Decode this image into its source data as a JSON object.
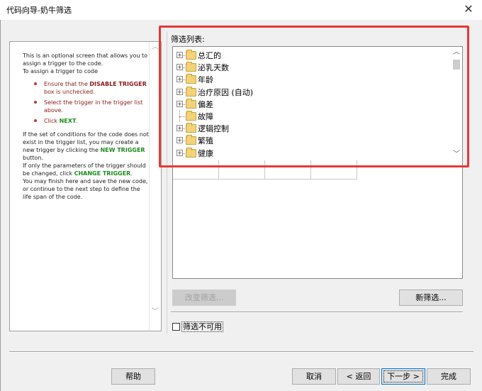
{
  "window": {
    "title": "代码向导-奶牛筛选",
    "close_glyph": "✕"
  },
  "help": {
    "intro": "This is an optional screen that allows you to assign a trigger to the code.",
    "intro2": "To assign a trigger to code",
    "steps": [
      {
        "pre": "Ensure that the ",
        "kw": "DISABLE TRIGGER",
        "post": " box is unchecked."
      },
      {
        "pre": "Select the trigger in the trigger list above.",
        "kw": "",
        "post": ""
      },
      {
        "pre": "Click ",
        "kw": "NEXT",
        "post": "."
      }
    ],
    "para2_pre": "If the set of conditions for the code does not exist in the trigger list, you may create a new trigger by clicking the ",
    "para2_kw": "NEW TRIGGER",
    "para2_post": " button.",
    "para3_pre": "If only the parameters of the trigger should be changed, click ",
    "para3_kw": "CHANGE TRIGGER",
    "para3_post": ".",
    "para4": "You may finish here and save the new code, or continue to the next step to define the life span of the code.",
    "scroll_up": "︿",
    "scroll_down": "﹀"
  },
  "filter": {
    "label": "筛选列表:",
    "items": [
      {
        "label": "总汇的",
        "expandable": true
      },
      {
        "label": "泌乳天数",
        "expandable": true
      },
      {
        "label": "年龄",
        "expandable": true
      },
      {
        "label": "治疗原因 (自动)",
        "expandable": true
      },
      {
        "label": "偏差",
        "expandable": true
      },
      {
        "label": "故障",
        "expandable": false
      },
      {
        "label": "逻辑控制",
        "expandable": true
      },
      {
        "label": "繁殖",
        "expandable": true
      },
      {
        "label": "健康",
        "expandable": true
      }
    ],
    "expand_glyph": "+",
    "scroll_up": "︿",
    "scroll_down": "﹀"
  },
  "buttons": {
    "change_filter": "改变筛选...",
    "new_filter": "新筛选...",
    "help": "帮助",
    "cancel": "取消",
    "back": "< 返回",
    "next": "下一步 >",
    "finish": "完成"
  },
  "checkbox": {
    "label": "筛选不可用",
    "checked": false
  },
  "colors": {
    "highlight": "#e53935",
    "keyword_red": "#8b1a1a",
    "keyword_green": "#1e8b1e"
  }
}
